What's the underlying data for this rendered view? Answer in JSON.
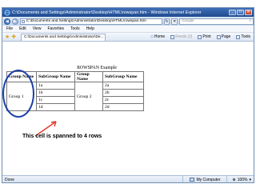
{
  "window": {
    "title": "C:\\Documents and Settings\\Administrator\\Desktop\\HTML\\rowspan.htm - Windows Internet Explorer",
    "controls": {
      "minimize": "_",
      "maximize": "□",
      "close": "✕"
    }
  },
  "address_bar": {
    "url": "C:\\Documents and Settings\\Administrator\\Desktop\\HTML\\rowspan.htm",
    "search_placeholder": "Google",
    "back_glyph": "◀",
    "forward_glyph": "▶",
    "refresh_glyph": "↻",
    "stop_glyph": "✕",
    "search_glyph": "⌕"
  },
  "menu": [
    "File",
    "Edit",
    "View",
    "Favorites",
    "Tools",
    "Help"
  ],
  "favorites_bar": {
    "tab_label": "C:\\Documents and Settings\\Administrator\\De...",
    "tab_close_glyph": "×",
    "commands": [
      "Home",
      "Feeds (J)",
      "Print",
      "Page",
      "Tools"
    ]
  },
  "page": {
    "caption": "ROWSPAN Example",
    "headers": [
      "Group Name",
      "SubGroup Name",
      "Group Name",
      "SubGroup Name"
    ],
    "group1": "Group 1",
    "group2": "Group 2",
    "rows": [
      {
        "sub1": "1a",
        "sub2": "2a"
      },
      {
        "sub1": "1b",
        "sub2": "2b"
      },
      {
        "sub1": "1c",
        "sub2": "2c"
      },
      {
        "sub1": "1d",
        "sub2": "2d"
      }
    ],
    "annotation": "This cell is spanned to 4 rows",
    "annotation_color": "#e0392b",
    "highlight_color": "#1d3fa8"
  },
  "status_bar": {
    "left": "Done",
    "zone": "My Computer",
    "zoom": "100%",
    "zoom_arrow": "▾"
  }
}
